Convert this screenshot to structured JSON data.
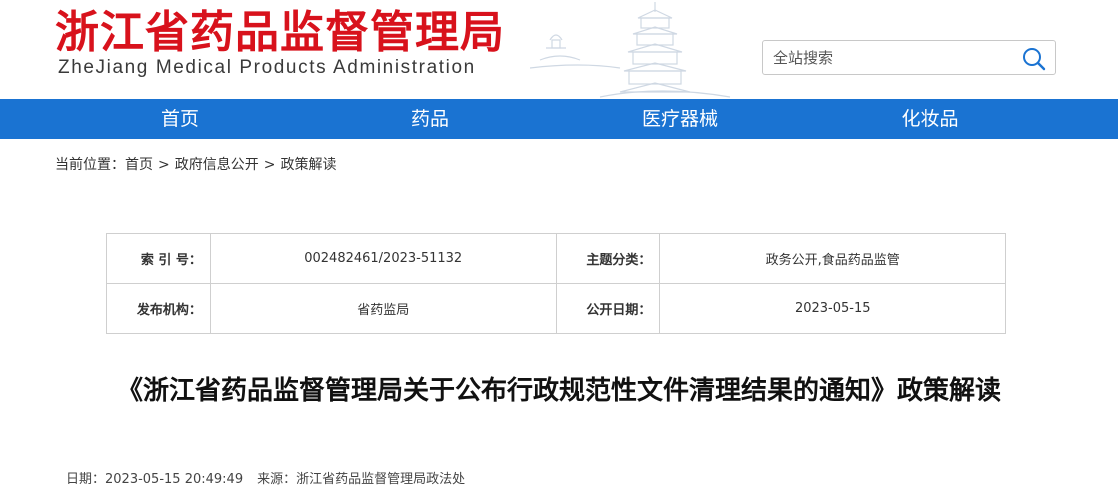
{
  "header": {
    "logo_cn": "浙江省药品监督管理局",
    "logo_en": "ZheJiang Medical Products Administration",
    "brand_color": "#d8121c"
  },
  "search": {
    "placeholder": "全站搜索",
    "icon": "search-icon"
  },
  "nav": {
    "color": "#1a73d2",
    "items": [
      {
        "label": "首页"
      },
      {
        "label": "药品"
      },
      {
        "label": "医疗器械"
      },
      {
        "label": "化妆品"
      }
    ]
  },
  "breadcrumb": {
    "prefix": "当前位置：",
    "items": [
      "首页",
      "政府信息公开",
      "政策解读"
    ],
    "separator": ">"
  },
  "info": {
    "index_label": "索 引 号：",
    "index_value": "002482461/2023-51132",
    "topic_label": "主题分类：",
    "topic_value": "政务公开,食品药品监管",
    "publisher_label": "发布机构：",
    "publisher_value": "省药监局",
    "date_label": "公开日期：",
    "date_value": "2023-05-15"
  },
  "article": {
    "title": "《浙江省药品监督管理局关于公布行政规范性文件清理结果的通知》政策解读",
    "date_label": "日期：",
    "date_value": "2023-05-15 20:49:49",
    "source_label": "来源：",
    "source_value": "浙江省药品监督管理局政法处"
  }
}
